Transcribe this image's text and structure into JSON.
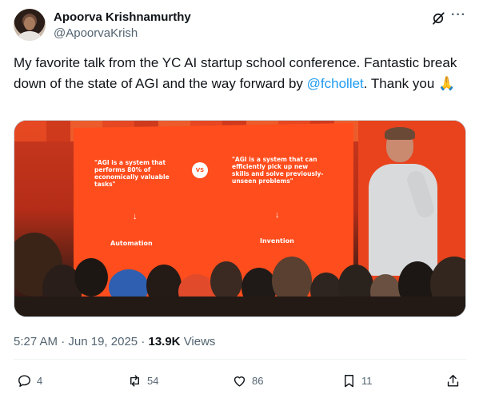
{
  "author": {
    "display_name": "Apoorva Krishnamurthy",
    "handle": "@ApoorvaKrish"
  },
  "header_icons": {
    "grok": "grok-icon",
    "more": "more-icon",
    "more_glyph": "···"
  },
  "tweet": {
    "text_before": "My favorite talk from the YC AI startup school conference. Fantastic break down of the state of AGI and the way forward by ",
    "mention": "@fchollet",
    "text_after": ". Thank you 🙏"
  },
  "media": {
    "slide_left_quote": "\"AGI is a system that performs 80% of economically valuable tasks\"",
    "slide_vs": "VS",
    "slide_right_quote": "\"AGI is a system that can efficiently pick up new skills and solve previously-unseen problems\"",
    "slide_left_label": "Automation",
    "slide_right_label": "Invention",
    "arrow_glyph": "↓"
  },
  "meta": {
    "time": "5:27 AM",
    "separator": "·",
    "date": "Jun 19, 2025",
    "separator2": "·",
    "views_count": "13.9K",
    "views_label": "Views"
  },
  "actions": {
    "replies": "4",
    "reposts": "54",
    "likes": "86",
    "bookmarks": "11"
  },
  "colors": {
    "accent": "#1d9bf0",
    "text_primary": "#0f1419",
    "text_secondary": "#536471",
    "slide_orange": "#ff4d1d"
  }
}
